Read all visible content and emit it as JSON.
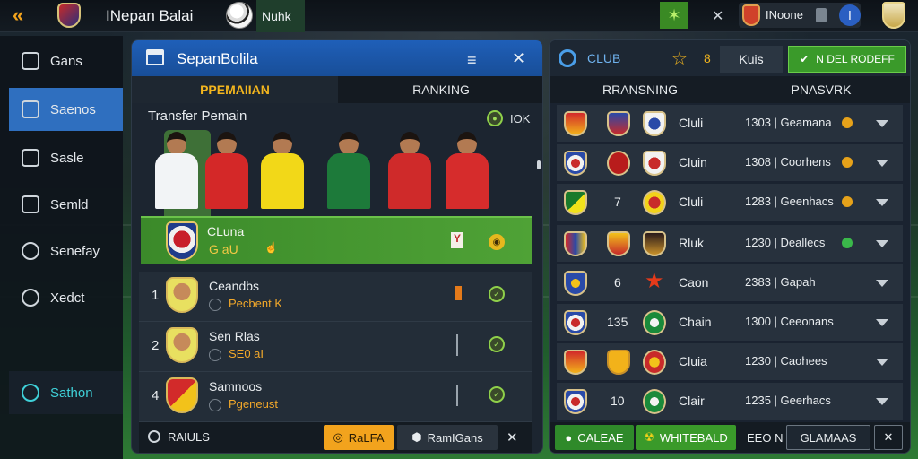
{
  "topbar": {
    "title": "INepan Balai",
    "team_label": "Nuhk",
    "club_name": "INoone",
    "star_icon": "star-icon",
    "back_icon": "double-chevron-left-icon"
  },
  "sidebar": {
    "items": [
      {
        "label": "Gans",
        "icon": "layers-icon"
      },
      {
        "label": "Saenos",
        "icon": "check-square-icon",
        "active": true
      },
      {
        "label": "Sasle",
        "icon": "document-icon"
      },
      {
        "label": "Semld",
        "icon": "cube-icon"
      },
      {
        "label": "Senefay",
        "icon": "share-icon"
      },
      {
        "label": "Xedct",
        "icon": "brain-icon"
      },
      {
        "label": "Sathon",
        "icon": "clock-icon",
        "highlight": true
      }
    ]
  },
  "center": {
    "title": "SepanBolila",
    "tabs": [
      {
        "label": "PPEMAIIAN",
        "active": true
      },
      {
        "label": "RANKING",
        "active": false
      }
    ],
    "section_title": "Transfer Pemain",
    "count_label": "IOK",
    "club_card": {
      "name": "CLuna",
      "value": "G aU"
    },
    "players_list": [
      {
        "rank": "1",
        "name": "Ceandbs",
        "sub": "Pecbent K"
      },
      {
        "rank": "2",
        "name": "Sen Rlas",
        "sub": "SE0 aI"
      },
      {
        "rank": "4",
        "name": "Samnoos",
        "sub": "Pgeneust"
      }
    ],
    "bottom": {
      "results_label": "RAIULS",
      "orange_button": "RaLFA",
      "rankings_button": "RamIGans"
    }
  },
  "right": {
    "club_label": "CLUB",
    "number_badge": "8",
    "kuis_label": "Kuis",
    "green_button": "N DEL RODEFF",
    "col_headers": [
      "RRANSNING",
      "PNASVRK"
    ],
    "rows": [
      {
        "num": "",
        "name": "Cluli",
        "score": "1303 | Geamana"
      },
      {
        "num": "",
        "name": "Cluin",
        "score": "1308 | Coorhens"
      },
      {
        "num": "7",
        "name": "Cluli",
        "score": "1283 | Geenhacs"
      },
      {
        "num": "",
        "name": "Rluk",
        "score": "1230 | Deallecs"
      },
      {
        "num": "6",
        "name": "Caon",
        "score": "2383 | Gapah"
      },
      {
        "num": "135",
        "name": "Chain",
        "score": "1300 | Ceeonans"
      },
      {
        "num": "",
        "name": "Cluia",
        "score": "1230 | Caohees"
      },
      {
        "num": "10",
        "name": "Clair",
        "score": "1235 | Geerhacs"
      }
    ],
    "bottom": {
      "cancel_label": "CALEAE",
      "world_label": "WHITEBALD",
      "eon_label": "EEO N",
      "glamas_label": "GLAMAAS"
    }
  },
  "colors": {
    "accent_blue": "#1f5fb8",
    "accent_gold": "#f2b51e",
    "accent_green": "#3b8a2a",
    "teal": "#3fd0d8"
  }
}
